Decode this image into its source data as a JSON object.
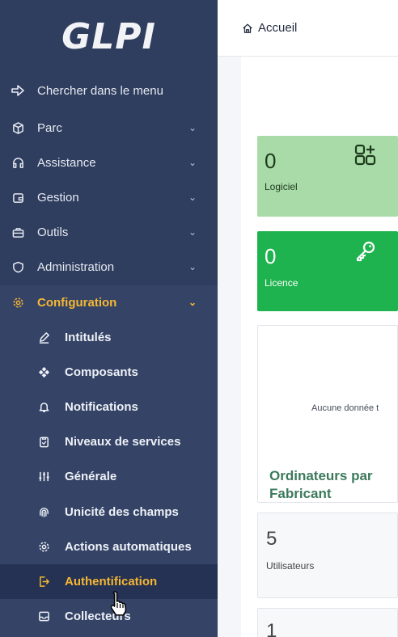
{
  "app": {
    "logo_text": "GLPI"
  },
  "sidebar": {
    "search_label": "Chercher dans le menu",
    "items": [
      {
        "label": "Parc",
        "icon": "cube-icon"
      },
      {
        "label": "Assistance",
        "icon": "headset-icon"
      },
      {
        "label": "Gestion",
        "icon": "wallet-icon"
      },
      {
        "label": "Outils",
        "icon": "briefcase-icon"
      },
      {
        "label": "Administration",
        "icon": "shield-icon"
      },
      {
        "label": "Configuration",
        "icon": "gear-icon"
      }
    ],
    "active_item": "Configuration",
    "sub_items": [
      {
        "label": "Intitulés",
        "icon": "pencil-icon"
      },
      {
        "label": "Composants",
        "icon": "components-icon"
      },
      {
        "label": "Notifications",
        "icon": "bell-icon"
      },
      {
        "label": "Niveaux de services",
        "icon": "clipboard-icon"
      },
      {
        "label": "Générale",
        "icon": "sliders-icon"
      },
      {
        "label": "Unicité des champs",
        "icon": "fingerprint-icon"
      },
      {
        "label": "Actions automatiques",
        "icon": "cog-icon"
      },
      {
        "label": "Authentification",
        "icon": "login-icon"
      },
      {
        "label": "Collecteurs",
        "icon": "inbox-icon"
      }
    ],
    "selected_sub_item": "Authentification"
  },
  "header": {
    "breadcrumb_home": "Accueil"
  },
  "dashboard": {
    "cards": [
      {
        "value": "0",
        "label": "Logiciel"
      },
      {
        "value": "0",
        "label": "Licence"
      }
    ],
    "chart_card": {
      "empty_text": "Aucune donnée t",
      "title": "Ordinateurs par Fabricant"
    },
    "users_card": {
      "value": "5",
      "label": "Utilisateurs"
    },
    "next_card": {
      "value": "1"
    }
  },
  "colors": {
    "sidebar_bg": "#2f3d5e",
    "active": "#f7b733",
    "logiciel_card": "#a8dba8",
    "licence_card": "#1fb34f",
    "chart_title": "#3c7a5c"
  }
}
